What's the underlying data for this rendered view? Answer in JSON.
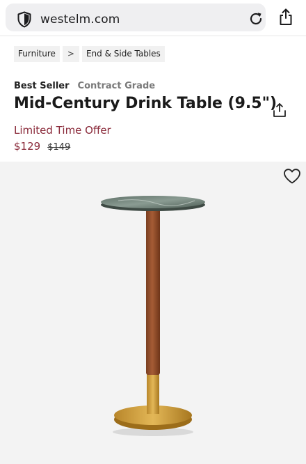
{
  "browser": {
    "url": "westelm.com"
  },
  "breadcrumb": {
    "items": [
      {
        "label": "Furniture"
      },
      {
        "label": "End & Side Tables"
      }
    ],
    "separator": ">"
  },
  "product": {
    "badges": {
      "best_seller": "Best Seller",
      "contract_grade": "Contract Grade"
    },
    "title": "Mid-Century Drink Table (9.5\")",
    "offer_label": "Limited Time Offer",
    "price_current": "$129",
    "price_original": "$149"
  },
  "icons": {
    "browser_shield": "shield-icon",
    "reload": "reload-icon",
    "browser_share": "share-icon",
    "product_share": "share-icon",
    "favorite": "heart-icon"
  },
  "colors": {
    "sale_accent": "#8a2a3a",
    "hero_background": "#f3f3f3",
    "url_bar_background": "#efeff1"
  }
}
